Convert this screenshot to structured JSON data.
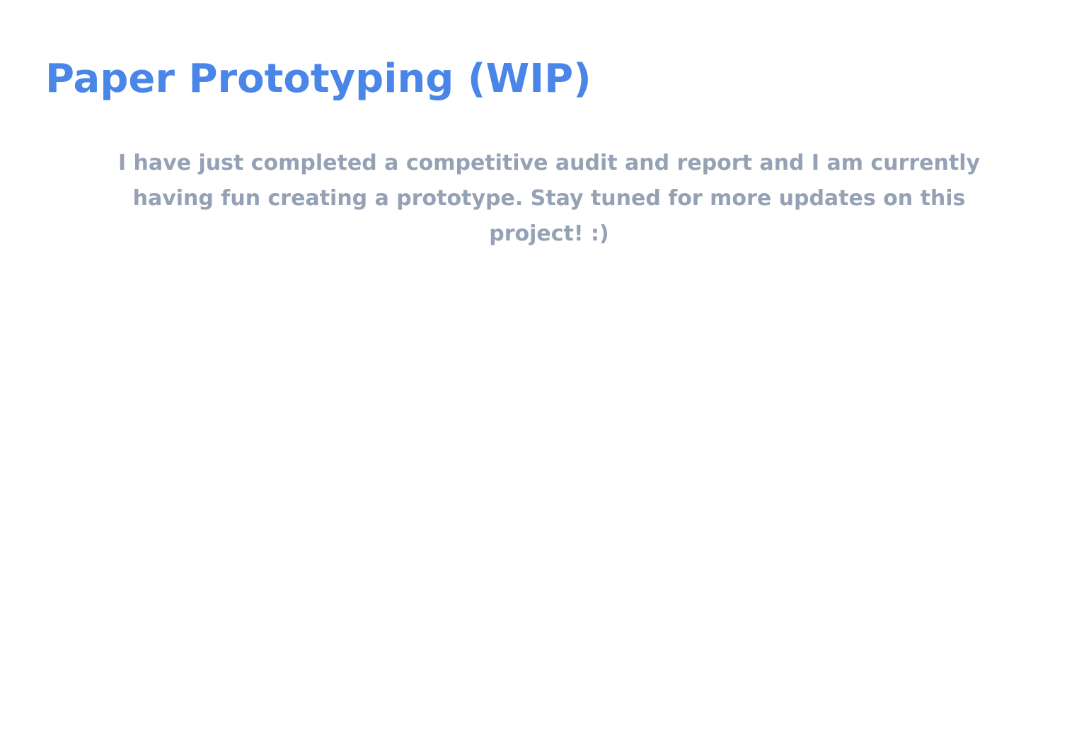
{
  "page": {
    "title": "Paper Prototyping (WIP)",
    "description": "I have just completed a competitive audit and report and I am currently having fun creating a prototype. Stay tuned for more updates on this project! :)"
  },
  "colors": {
    "title": "#4a86e8",
    "body_text": "#95a1b4",
    "background": "#ffffff"
  }
}
